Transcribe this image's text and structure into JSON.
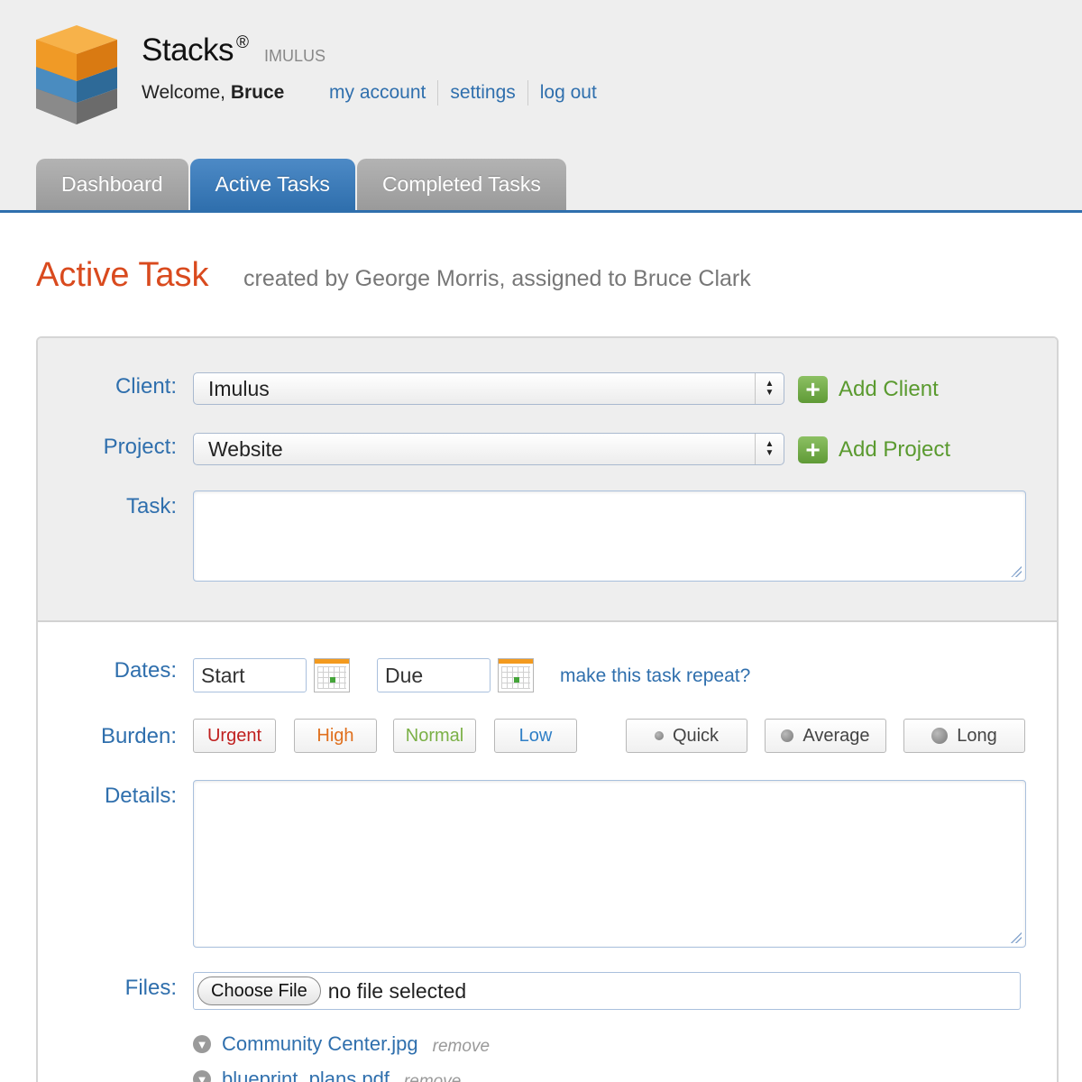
{
  "header": {
    "app_title": "Stacks",
    "registered_mark": "®",
    "org_name": "IMULUS",
    "welcome_prefix": "Welcome,",
    "user_name": "Bruce",
    "links": [
      "my account",
      "settings",
      "log out"
    ]
  },
  "tabs": [
    {
      "label": "Dashboard",
      "active": false
    },
    {
      "label": "Active Tasks",
      "active": true
    },
    {
      "label": "Completed Tasks",
      "active": false
    }
  ],
  "page": {
    "title": "Active Task",
    "subtitle": "created by George Morris, assigned to Bruce Clark"
  },
  "form": {
    "client_label": "Client:",
    "client_value": "Imulus",
    "add_client": "Add Client",
    "project_label": "Project:",
    "project_value": "Website",
    "add_project": "Add Project",
    "task_label": "Task:",
    "dates_label": "Dates:",
    "start_placeholder": "Start",
    "due_placeholder": "Due",
    "repeat_link": "make this task repeat?",
    "burden_label": "Burden:",
    "priority": [
      "Urgent",
      "High",
      "Normal",
      "Low"
    ],
    "duration": [
      "Quick",
      "Average",
      "Long"
    ],
    "details_label": "Details:",
    "files_label": "Files:",
    "choose_file": "Choose File",
    "no_file": "no file selected",
    "files": [
      {
        "name": "Community Center.jpg",
        "remove": "remove"
      },
      {
        "name": "blueprint_plans.pdf",
        "remove": "remove"
      }
    ]
  },
  "colors": {
    "brand_blue": "#2f6fad",
    "title_orange": "#d94a1e",
    "urgent": "#c0201f",
    "high": "#e0701e",
    "normal": "#7ab046",
    "low": "#2f7fc6",
    "add_green": "#5a9a2f"
  }
}
